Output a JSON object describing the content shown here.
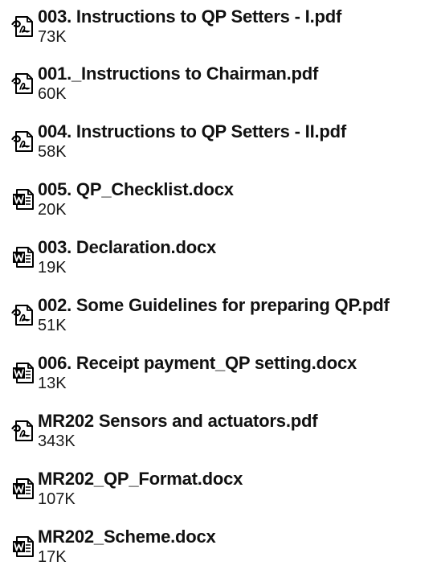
{
  "files": [
    {
      "name": "003. Instructions to QP Setters - I.pdf",
      "size": "73K",
      "type": "pdf",
      "icon": "pdf-file-icon"
    },
    {
      "name": "001._Instructions to Chairman.pdf",
      "size": "60K",
      "type": "pdf",
      "icon": "pdf-file-icon"
    },
    {
      "name": "004. Instructions to QP Setters - II.pdf",
      "size": "58K",
      "type": "pdf",
      "icon": "pdf-file-icon"
    },
    {
      "name": "005. QP_Checklist.docx",
      "size": "20K",
      "type": "docx",
      "icon": "word-file-icon"
    },
    {
      "name": "003. Declaration.docx",
      "size": "19K",
      "type": "docx",
      "icon": "word-file-icon"
    },
    {
      "name": "002. Some Guidelines for preparing QP.pdf",
      "size": "51K",
      "type": "pdf",
      "icon": "pdf-file-icon"
    },
    {
      "name": "006. Receipt payment_QP setting.docx",
      "size": "13K",
      "type": "docx",
      "icon": "word-file-icon"
    },
    {
      "name": "MR202 Sensors and actuators.pdf",
      "size": "343K",
      "type": "pdf",
      "icon": "pdf-file-icon"
    },
    {
      "name": "MR202_QP_Format.docx",
      "size": "107K",
      "type": "docx",
      "icon": "word-file-icon"
    },
    {
      "name": "MR202_Scheme.docx",
      "size": "17K",
      "type": "docx",
      "icon": "word-file-icon"
    }
  ]
}
